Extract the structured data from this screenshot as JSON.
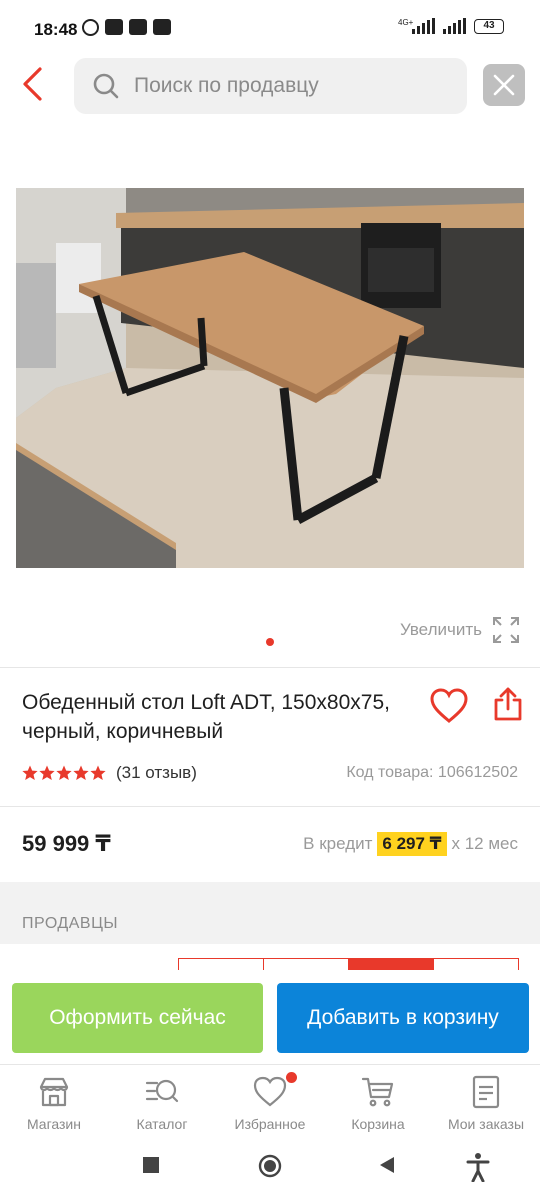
{
  "status_bar": {
    "time": "18:48",
    "network": "4G+",
    "battery": "43"
  },
  "search": {
    "placeholder": "Поиск по продавцу"
  },
  "product": {
    "zoom_label": "Увеличить",
    "title": "Обеденный стол Loft ADT, 150х80х75, черный, коричневый",
    "rating_stars": 5,
    "reviews": "(31 отзыв)",
    "sku": "Код товара: 106612502",
    "price": "59 999 ₸",
    "credit_prefix": "В кредит",
    "credit_amount": "6 297 ₸",
    "credit_suffix": "х 12 мес"
  },
  "sellers": {
    "title": "ПРОДАВЦЫ"
  },
  "actions": {
    "buy_now": "Оформить сейчас",
    "add_to_cart": "Добавить в корзину"
  },
  "tabbar": {
    "items": [
      {
        "label": "Магазин",
        "icon": "shop-icon"
      },
      {
        "label": "Каталог",
        "icon": "catalog-icon"
      },
      {
        "label": "Избранное",
        "icon": "heart-icon"
      },
      {
        "label": "Корзина",
        "icon": "cart-icon"
      },
      {
        "label": "Мои заказы",
        "icon": "orders-icon"
      }
    ]
  },
  "colors": {
    "accent_red": "#e8392b",
    "buy_green": "#9ad65c",
    "cart_blue": "#0c84d9",
    "credit_yellow": "#ffd21f"
  }
}
